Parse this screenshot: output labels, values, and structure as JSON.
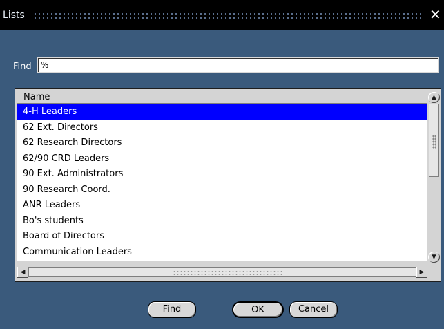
{
  "window": {
    "title": "Lists",
    "close_glyph": "✕"
  },
  "find_field": {
    "label": "Find",
    "value": "%"
  },
  "list": {
    "column_header": "Name",
    "rows": [
      "4-H Leaders",
      "62 Ext. Directors",
      "62 Research Directors",
      "62/90 CRD Leaders",
      "90 Ext.  Administrators",
      "90 Research Coord.",
      "ANR Leaders",
      "Bo's students",
      "Board of Directors",
      "Communication Leaders"
    ],
    "selected_index": 0
  },
  "scrollbars": {
    "up_icon": "▲",
    "down_icon": "▼",
    "left_icon": "◀",
    "right_icon": "▶"
  },
  "buttons": {
    "find": "Find",
    "ok": "OK",
    "cancel": "Cancel"
  },
  "colors": {
    "background": "#3a5a7c",
    "selection": "#0000ff"
  }
}
